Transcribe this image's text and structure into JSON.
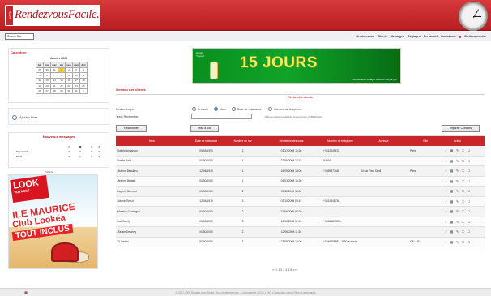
{
  "header": {
    "logo_prefix": "SANTE",
    "logo_text": "RendezvousFacile.com"
  },
  "toolbar": {
    "search_button": "Search Bar"
  },
  "nav": {
    "items": [
      "Rendez-vous",
      "Clients",
      "Messages",
      "Réglages",
      "Personnel",
      "Assistance",
      "Se déconnecter"
    ]
  },
  "sidebar": {
    "calendar_title": "Calendrier",
    "calendar_month": "Janvier 2009",
    "calendar_rows": [
      [
        "lun",
        "mar",
        "mer",
        "jeu",
        "ven",
        "sam",
        "dim"
      ],
      [
        "29",
        "30",
        "31",
        "1",
        "2",
        "3",
        "4"
      ],
      [
        "5",
        "6",
        "7",
        "8",
        "9",
        "10",
        "11"
      ],
      [
        "12",
        "13",
        "14",
        "15",
        "16",
        "17",
        "18"
      ],
      [
        "19",
        "20",
        "21",
        "22",
        "23",
        "24",
        "25"
      ],
      [
        "26",
        "27",
        "28",
        "29",
        "30",
        "31",
        "1"
      ]
    ],
    "note_label": "Ajouter Note",
    "messages_title": "Nouveaux messages",
    "messages_rows": [
      [
        "",
        "✉",
        "☎",
        "⚠",
        "#"
      ],
      [
        "Important",
        "0",
        "0",
        "0",
        "0"
      ],
      [
        "Total",
        "0",
        "0",
        "0",
        "0"
      ]
    ],
    "ad_label": "Publicité",
    "ad": {
      "look_line_1": "LOOK",
      "look_line_2": "VOYAGES",
      "line_1": "ILE MAURICE",
      "line_2": "Club Lookéa",
      "line_3": "TOUT INCLUS"
    }
  },
  "banner": {
    "brand_line_1": "Activia",
    "brand_line_2": "Yogourt",
    "headline": "15 JOURS",
    "tagline": "Pour démarrer, essayez Activia 2 fois par jour"
  },
  "search": {
    "panel_title": "Gestion des clients",
    "search_title": "Recherche clients",
    "search_by_label": "Recherche par:",
    "options": [
      "Prénom",
      "Nom",
      "Date de naissance",
      "Numéro de téléphone"
    ],
    "text_label": "Texte Recherché:",
    "hint": "Date de naissance doit être sous la forme (JJ/MM/AAAA)",
    "search_button": "Rechercher",
    "update_button": "Mise à jour",
    "import_button": "Importer Contacts"
  },
  "table": {
    "headers": [
      "Nom",
      "Date de naissance",
      "Nombre de rdv",
      "Dernier rendez-vous",
      "Numéro de téléphone",
      "Adresse",
      "Ville",
      "Action"
    ],
    "rows": [
      [
        "Valérie Andargou",
        "05/05/1990",
        "2",
        "03/12/2008 10:30",
        "+3312345678",
        "",
        "Paris"
      ],
      [
        "Yvette Bald",
        "00/00/0000",
        "1",
        "27/06/2008 17:15",
        "54654,",
        "",
        ""
      ],
      [
        "Jeanne Beaulieu",
        "12/06/1945",
        "1",
        "16/09/2008 14:00",
        "+3369473468",
        "34 rue Paul Sentl",
        "Paris"
      ],
      [
        "Jeanne Bedard",
        "00/00/0000",
        "1",
        "04/03/2008 15:30",
        "",
        "",
        ""
      ],
      [
        "Laporte Bernard",
        "00/00/0000",
        "2",
        "09/12/2008 14:00",
        "",
        "",
        ""
      ],
      [
        "Jolanin Breux",
        "12/04/1979",
        "3",
        "02/10/2008 09:15",
        "+3312345789,",
        "",
        ""
      ],
      [
        "Maurice Chabogue",
        "00/00/0000",
        "2",
        "21/06/2008 08:30",
        "",
        "",
        ""
      ],
      [
        "Luc Dernly",
        "00/00/0000",
        "3",
        "16/10/2008 17:15",
        "+3346587987h,",
        "",
        ""
      ],
      [
        "Jürgen Delaney",
        "00/00/0000",
        "2",
        "12/06/2008 11:30",
        "",
        "",
        ""
      ],
      [
        "Cl Darian",
        "00/00/0000",
        "3",
        "23/09/2008 14:00",
        "+3346258987, 1850 avenue",
        "",
        "CALAIS"
      ]
    ],
    "pager": "<<< 1 2 3 4 5 6 >>>"
  },
  "footer": {
    "text": "© 2007-2009 Rendez-vous Facile. Tous droits réservés — Nouveautés | CGU | FAQ | Contactez-nous | Dites-le à vos amis"
  }
}
